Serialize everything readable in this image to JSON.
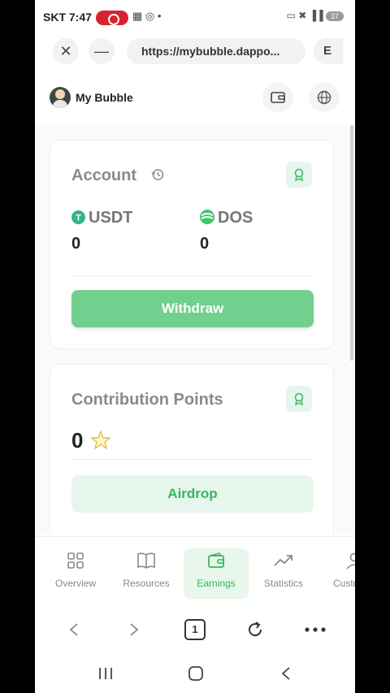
{
  "status_bar": {
    "carrier": "SKT",
    "time": "7:47",
    "battery": "37"
  },
  "browser": {
    "url": "https://mybubble.dappo...",
    "tab_label": "E",
    "tab_count": "1"
  },
  "app": {
    "name": "My Bubble"
  },
  "account": {
    "title": "Account",
    "coins": [
      {
        "symbol": "USDT",
        "value": "0",
        "icon": "tether-icon"
      },
      {
        "symbol": "DOS",
        "value": "0",
        "icon": "dos-icon"
      }
    ],
    "withdraw_label": "Withdraw"
  },
  "contribution": {
    "title": "Contribution Points",
    "value": "0",
    "airdrop_label": "Airdrop"
  },
  "tabs": [
    {
      "label": "Overview",
      "icon": "grid-icon",
      "active": false
    },
    {
      "label": "Resources",
      "icon": "book-icon",
      "active": false
    },
    {
      "label": "Earnings",
      "icon": "wallet-icon",
      "active": true
    },
    {
      "label": "Statistics",
      "icon": "trend-icon",
      "active": false
    },
    {
      "label": "Custo",
      "icon": "user-icon",
      "active": false
    }
  ],
  "colors": {
    "accent_green": "#72cf8e",
    "accent_green_text": "#2fb857",
    "soft_green_bg": "#e7f6ec",
    "record_red": "#d8222f"
  }
}
